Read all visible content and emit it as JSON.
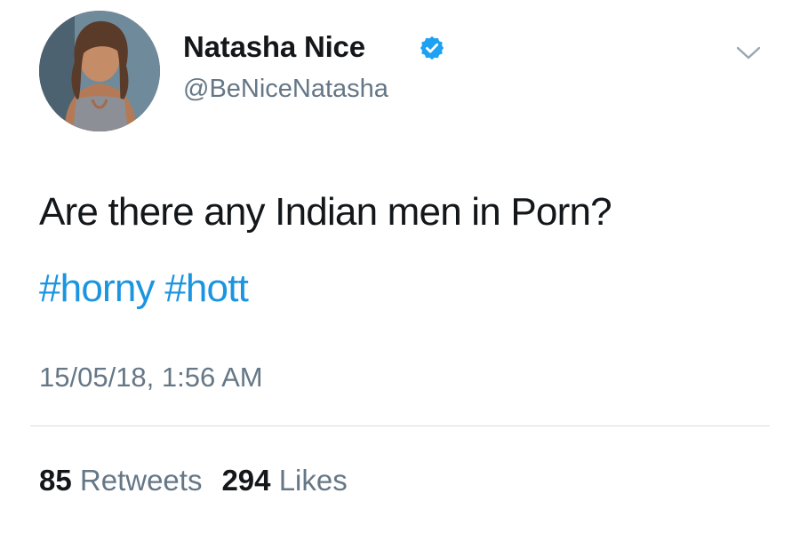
{
  "tweet": {
    "author": {
      "display_name": "Natasha Nice",
      "handle": "@BeNiceNatasha",
      "verified": true,
      "verified_color": "#1da1f2"
    },
    "text": "Are there any Indian men in Porn?",
    "hashtags": [
      "#horny",
      "#hott"
    ],
    "timestamp": "15/05/18, 1:56 AM",
    "stats": {
      "retweets_count": "85",
      "retweets_label": "Retweets",
      "likes_count": "294",
      "likes_label": "Likes"
    }
  },
  "icons": {
    "verified": "verified-badge-icon",
    "menu": "chevron-down-icon"
  },
  "colors": {
    "link": "#1b95e0",
    "secondary_text": "#657786",
    "primary_text": "#14171a"
  }
}
